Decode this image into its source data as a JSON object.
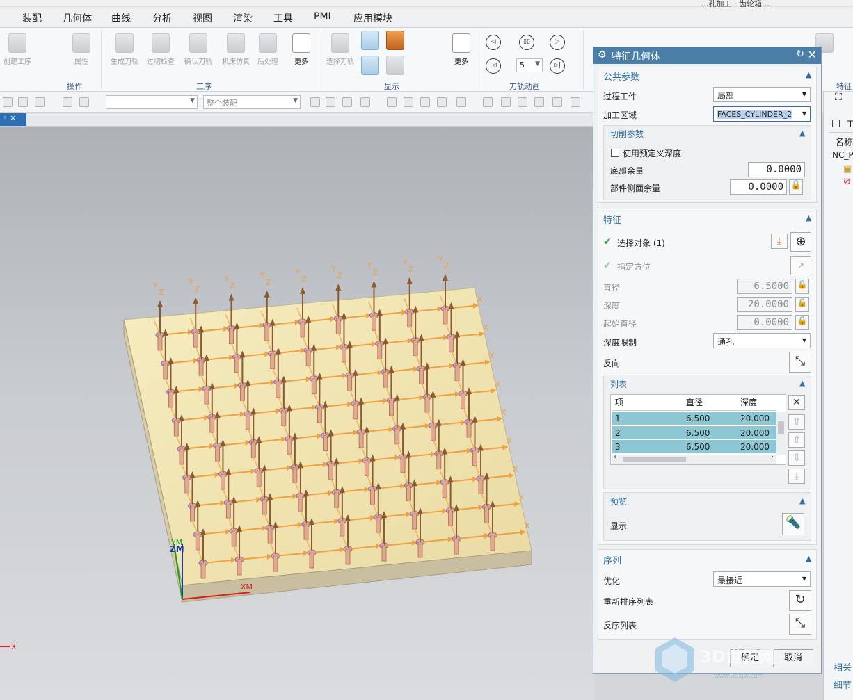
{
  "title": {
    "text": "…孔加工 · 齿轮箱…"
  },
  "menu": [
    "装配",
    "几何体",
    "曲线",
    "分析",
    "视图",
    "渲染",
    "工具",
    "PMI",
    "应用模块"
  ],
  "ribbon": {
    "buttons": [
      "创建工序",
      "属性",
      "生成刀轨",
      "过切检查",
      "确认刀轨",
      "机床仿真",
      "后处理",
      "更多",
      "选择刀轨",
      "更多"
    ],
    "groups": [
      "操作",
      "工序",
      "显示",
      "刀轨动画",
      "特征"
    ],
    "anim_speed": "5",
    "anim_buttons": [
      "◁",
      "▯▯",
      "▷",
      "|◁",
      "▷|"
    ]
  },
  "toolbar2": {
    "filter_placeholder": "",
    "assembly_scope": "整个装配"
  },
  "doc_tab": {
    "label": "◦ ×"
  },
  "viewport": {
    "axis_labels": {
      "x": "X",
      "y": "Y",
      "z": "Z",
      "xm": "XM",
      "ym": "YM",
      "zm": "ZM"
    },
    "grid": {
      "rows": 9,
      "cols": 9
    }
  },
  "dialog": {
    "title": "特征几何体",
    "common": {
      "heading": "公共参数",
      "process_workpiece_label": "过程工件",
      "process_workpiece_value": "局部",
      "machining_area_label": "加工区域",
      "machining_area_value": "FACES_CYLINDER_2",
      "cut_params": {
        "heading": "切削参数",
        "use_predefined_depth": "使用预定义深度",
        "bottom_stock_label": "底部余量",
        "bottom_stock_value": "0.0000",
        "side_stock_label": "部件侧面余量",
        "side_stock_value": "0.0000"
      }
    },
    "feature": {
      "heading": "特征",
      "select_object": "选择对象 (1)",
      "specify_orientation": "指定方位",
      "diameter_label": "直径",
      "diameter_value": "6.5000",
      "depth_label": "深度",
      "depth_value": "20.0000",
      "start_diameter_label": "起始直径",
      "start_diameter_value": "0.0000",
      "depth_limit_label": "深度限制",
      "depth_limit_value": "通孔",
      "reverse_label": "反向",
      "list": {
        "heading": "列表",
        "columns": [
          "项",
          "直径",
          "深度"
        ],
        "rows": [
          {
            "item": "1",
            "diameter": "6.500",
            "depth": "20.000"
          },
          {
            "item": "2",
            "diameter": "6.500",
            "depth": "20.000"
          },
          {
            "item": "3",
            "diameter": "6.500",
            "depth": "20.000"
          }
        ]
      },
      "preview": {
        "heading": "预览",
        "display_label": "显示"
      }
    },
    "sequence": {
      "heading": "序列",
      "optimize_label": "优化",
      "optimize_value": "最接近",
      "reorder_label": "重新排序列表",
      "reverse_list_label": "反序列表"
    },
    "ok": "确定",
    "cancel": "取消"
  },
  "navigator": {
    "title": "工",
    "name_header": "名称",
    "root": "NC_P",
    "tabs": [
      "相关",
      "细节"
    ]
  },
  "watermark": {
    "text": "3D世界网",
    "url": "www.3dsjw.com"
  }
}
